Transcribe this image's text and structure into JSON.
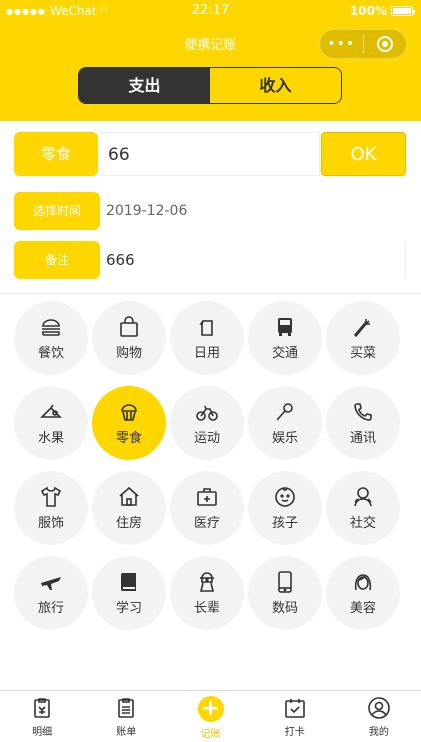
{
  "statusbar": {
    "carrier": "WeChat",
    "time": "22:17",
    "battery": "100%"
  },
  "navbar": {
    "title": "便携记账",
    "more_icon": "•••"
  },
  "tabs": [
    {
      "label": "支出",
      "active": true
    },
    {
      "label": "收入",
      "active": false
    }
  ],
  "form": {
    "category_label": "零食",
    "amount": "66",
    "ok_label": "OK",
    "date_label": "选择时间",
    "date_value": "2019-12-06",
    "note_label": "备注",
    "note_value": "666"
  },
  "categories": [
    {
      "name": "餐饮",
      "icon": "burger-icon"
    },
    {
      "name": "购物",
      "icon": "shopping-bag-icon"
    },
    {
      "name": "日用",
      "icon": "tissue-icon"
    },
    {
      "name": "交通",
      "icon": "bus-icon"
    },
    {
      "name": "买菜",
      "icon": "carrot-icon"
    },
    {
      "name": "水果",
      "icon": "fruit-icon"
    },
    {
      "name": "零食",
      "icon": "cupcake-icon",
      "selected": true
    },
    {
      "name": "运动",
      "icon": "bicycle-icon"
    },
    {
      "name": "娱乐",
      "icon": "microphone-icon"
    },
    {
      "name": "通讯",
      "icon": "phone-icon"
    },
    {
      "name": "服饰",
      "icon": "tshirt-icon"
    },
    {
      "name": "住房",
      "icon": "house-icon"
    },
    {
      "name": "医疗",
      "icon": "medical-kit-icon"
    },
    {
      "name": "孩子",
      "icon": "baby-icon"
    },
    {
      "name": "社交",
      "icon": "people-icon"
    },
    {
      "name": "旅行",
      "icon": "airplane-icon"
    },
    {
      "name": "学习",
      "icon": "book-icon"
    },
    {
      "name": "长辈",
      "icon": "elder-icon"
    },
    {
      "name": "数码",
      "icon": "smartphone-icon"
    },
    {
      "name": "美容",
      "icon": "woman-face-icon"
    }
  ],
  "bottom_nav": [
    {
      "label": "明细",
      "icon": "details-icon"
    },
    {
      "label": "账单",
      "icon": "bill-icon"
    },
    {
      "label": "记账",
      "icon": "plus-icon",
      "active": true
    },
    {
      "label": "打卡",
      "icon": "calendar-check-icon"
    },
    {
      "label": "我的",
      "icon": "user-icon"
    }
  ],
  "colors": {
    "brand": "#FED700",
    "dark": "#333333"
  }
}
